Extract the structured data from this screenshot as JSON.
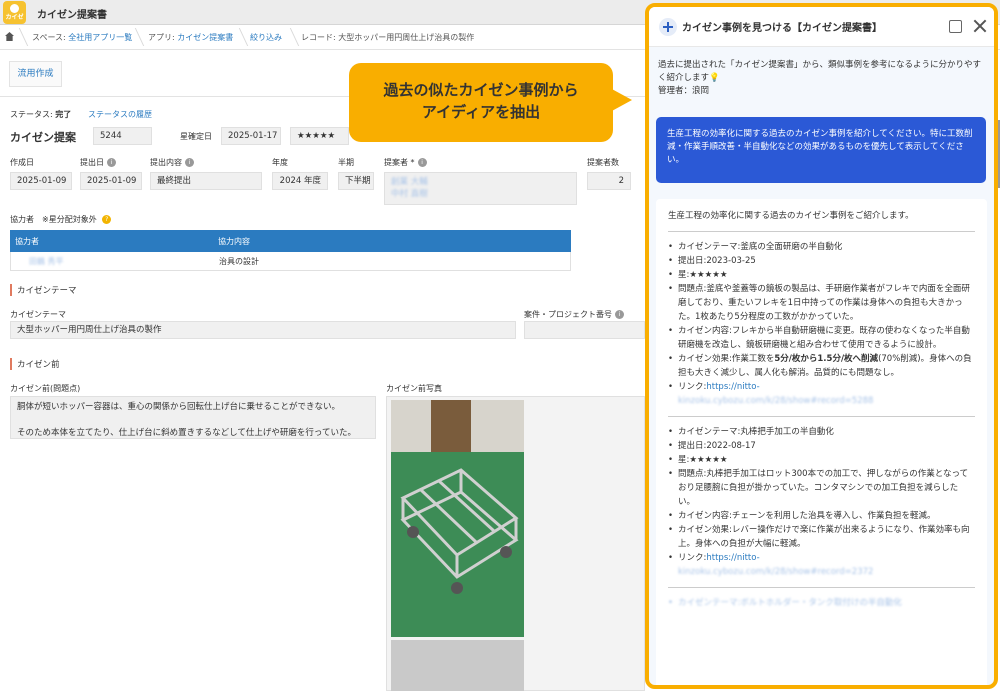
{
  "app": {
    "title": "カイゼン提案書",
    "logo_label": "カイゼン"
  },
  "breadcrumb": {
    "space_prefix": "スペース: ",
    "space": "全社用アプリ一覧",
    "app_prefix": "アプリ: ",
    "app": "カイゼン提案書",
    "filter": "絞り込み",
    "record": "レコード: 大型ホッパー用円周仕上げ治具の製作"
  },
  "actions": {
    "flow": "流用作成"
  },
  "status": {
    "label": "ステータス: ",
    "value": "完了",
    "history": "ステータスの履歴"
  },
  "record": {
    "title": "カイゼン提案",
    "id": "5244",
    "stars_label": "星確定日",
    "stars_date": "2025-01-17",
    "stars": "★★★★★",
    "fields": {
      "created_label": "作成日",
      "created": "2025-01-09",
      "submitted_label": "提出日",
      "submitted": "2025-01-09",
      "content_label": "提出内容",
      "content": "最終提出",
      "year_label": "年度",
      "year": "2024 年度",
      "half_label": "半期",
      "half": "下半期",
      "proposer_label": "提案者 *",
      "proposer1": "創業 大輔",
      "proposer2": "中村 直樹",
      "count_label": "提案者数",
      "count": "2"
    },
    "collaborators": {
      "label": "協力者",
      "note": "※星分配対象外",
      "help": "?",
      "col1": "協力者",
      "col2": "協力内容",
      "name": "田鶴 秀平",
      "detail": "治具の設計"
    },
    "theme_section": "カイゼンテーマ",
    "theme_label": "カイゼンテーマ",
    "theme": "大型ホッパー用円周仕上げ治具の製作",
    "project_label": "案件・プロジェクト番号",
    "before_section": "カイゼン前",
    "problem_label": "カイゼン前(問題点)",
    "photo_label": "カイゼン前写真",
    "problem1": "胴体が短いホッパー容器は、重心の関係から回転仕上げ台に乗せることができない。",
    "problem2": "そのため本体を立てたり、仕上げ台に斜め置きするなどして仕上げや研磨を行っていた。"
  },
  "callout": {
    "line1": "過去の似たカイゼン事例から",
    "line2": "アイディアを抽出"
  },
  "panel": {
    "title": "カイゼン事例を見つける【カイゼン提案書】",
    "intro": "過去に提出された「カイゼン提案書」から、類似事例を参考になるように分かりやすく紹介します💡",
    "manager": "管理者：浪岡",
    "query": "生産工程の効率化に関する過去のカイゼン事例を紹介してください。特に工数削減・作業手順改善・半自動化などの効果があるものを優先して表示してください。",
    "answer_intro": "生産工程の効率化に関する過去のカイゼン事例をご紹介します。",
    "case1": {
      "theme": "カイゼンテーマ:釜底の全面研磨の半自動化",
      "date": "提出日:2023-03-25",
      "stars": "星:★★★★★",
      "problem": "問題点:釜底や釜蓋等の鏡板の製品は、手研磨作業者がフレキで内面を全面研磨しており、重たいフレキを1日中持っての作業は身体への負担も大きかった。1枚あたり5分程度の工数がかかっていた。",
      "content": "カイゼン内容:フレキから半自動研磨機に変更。既存の使わなくなった半自動研磨機を改造し、鏡板研磨機と組み合わせて使用できるように設計。",
      "effect_a": "カイゼン効果:作業工数を",
      "effect_b": "5分/枚から1.5分/枚へ削減",
      "effect_c": "(70%削減)。身体への負担も大きく減少し、属人化も解消。品質的にも問題なし。",
      "link_label": "リンク:",
      "link": "https://nitto-",
      "link2": "kinzoku.cybozu.com/k/28/show#record=5288"
    },
    "case2": {
      "theme": "カイゼンテーマ:丸棒把手加工の半自動化",
      "date": "提出日:2022-08-17",
      "stars": "星:★★★★★",
      "problem": "問題点:丸棒把手加工はロット300本での加工で、押しながらの作業となっており足腰腕に負担が掛かっていた。コンタマシンでの加工負担を減らしたい。",
      "content": "カイゼン内容:チェーンを利用した治具を導入し、作業負担を軽減。",
      "effect": "カイゼン効果:レバー操作だけで楽に作業が出来るようになり、作業効率も向上。身体への負担が大幅に軽減。",
      "link_label": "リンク:",
      "link": "https://nitto-",
      "link2": "kinzoku.cybozu.com/k/28/show#record=2372"
    },
    "case3_partial": "カイゼンテーマ:ボルトホルダー・タンク取付けの半自動化"
  }
}
